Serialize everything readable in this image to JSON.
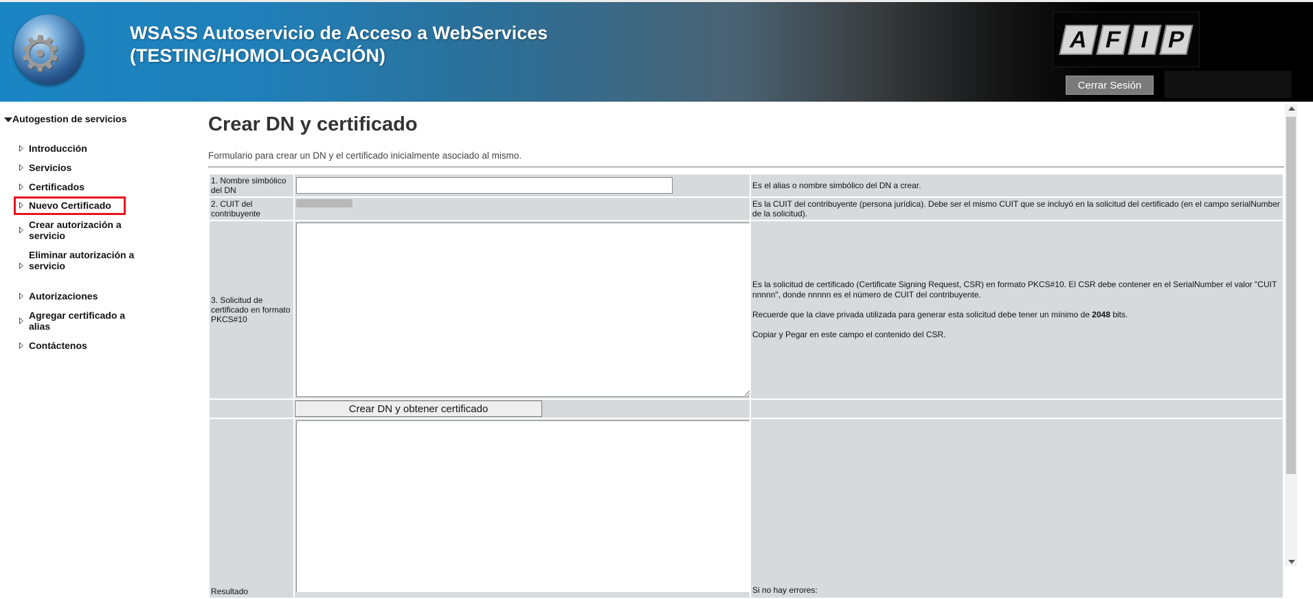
{
  "header": {
    "title_line1": "WSASS Autoservicio de Acceso a WebServices",
    "title_line2": "(TESTING/HOMOLOGACIÓN)",
    "brand_letters": [
      "A",
      "F",
      "I",
      "P"
    ],
    "logout_label": "Cerrar Sesión",
    "logo_icon": "gear-globe-icon"
  },
  "sidebar": {
    "root_label": "Autogestion de servicios",
    "items": [
      {
        "label": "Introducción"
      },
      {
        "label": "Servicios"
      },
      {
        "label": "Certificados"
      },
      {
        "label": "Nuevo Certificado",
        "highlighted": true
      },
      {
        "label": "Crear autorización a servicio"
      },
      {
        "label": "Eliminar autorización a servicio"
      },
      {
        "label": "Autorizaciones"
      },
      {
        "label": "Agregar certificado a alias"
      },
      {
        "label": "Contáctenos"
      }
    ]
  },
  "main": {
    "title": "Crear DN y certificado",
    "description": "Formulario para crear un DN y el certificado inicialmente asociado al mismo.",
    "form": {
      "rows": [
        {
          "label": "1. Nombre simbólico del DN",
          "input_value": "",
          "help": "Es el alias o nombre simbólico del DN a crear."
        },
        {
          "label": "2. CUIT del contribuyente",
          "help": "Es la CUIT del contribuyente (persona jurídica). Debe ser el mismo CUIT que se incluyó en la solicitud del certificado (en el campo serialNumber de la solicitud)."
        },
        {
          "label": "3. Solicitud de certificado en formato PKCS#10",
          "textarea_value": "",
          "help_p1": "Es la solicitud de certificado (Certificate Signing Request, CSR) en formato PKCS#10. El CSR debe contener en el SerialNumber el valor \"CUIT nnnnn\", donde nnnnn es el número de CUIT del contribuyente.",
          "help_p2_before": "Recuerde que la clave privada utilizada para generar esta solicitud debe tener un mínimo de ",
          "help_p2_bold": "2048",
          "help_p2_after": " bits.",
          "help_p3": "Copiar y Pegar en este campo el contenido del CSR."
        }
      ],
      "submit_label": "Crear DN y obtener certificado",
      "result": {
        "label": "Resultado",
        "textarea_value": "",
        "help": "Si no hay errores:"
      }
    }
  },
  "colors": {
    "header_blue": "#1a85c3",
    "table_cell_bg": "#d6dadd",
    "highlight_red": "#e8121c"
  }
}
